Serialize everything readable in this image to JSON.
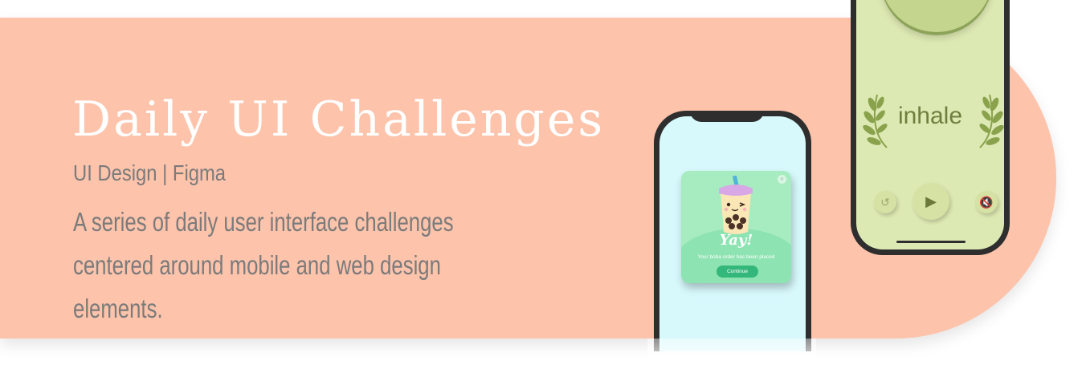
{
  "banner": {
    "title": "Daily UI Challenges",
    "subtitle": "UI Design | Figma",
    "description": "A series of daily user interface challenges centered around mobile and web design elements.",
    "bg_color": "#fdc3ab"
  },
  "phone_boba": {
    "card": {
      "headline": "Yay!",
      "message": "Your boba order has been placed",
      "button": "Continue",
      "close": "×"
    }
  },
  "phone_breathing": {
    "word": "inhale",
    "controls": {
      "replay_icon": "replay-icon",
      "play_icon": "play-icon",
      "mute_icon": "mute-icon"
    }
  }
}
